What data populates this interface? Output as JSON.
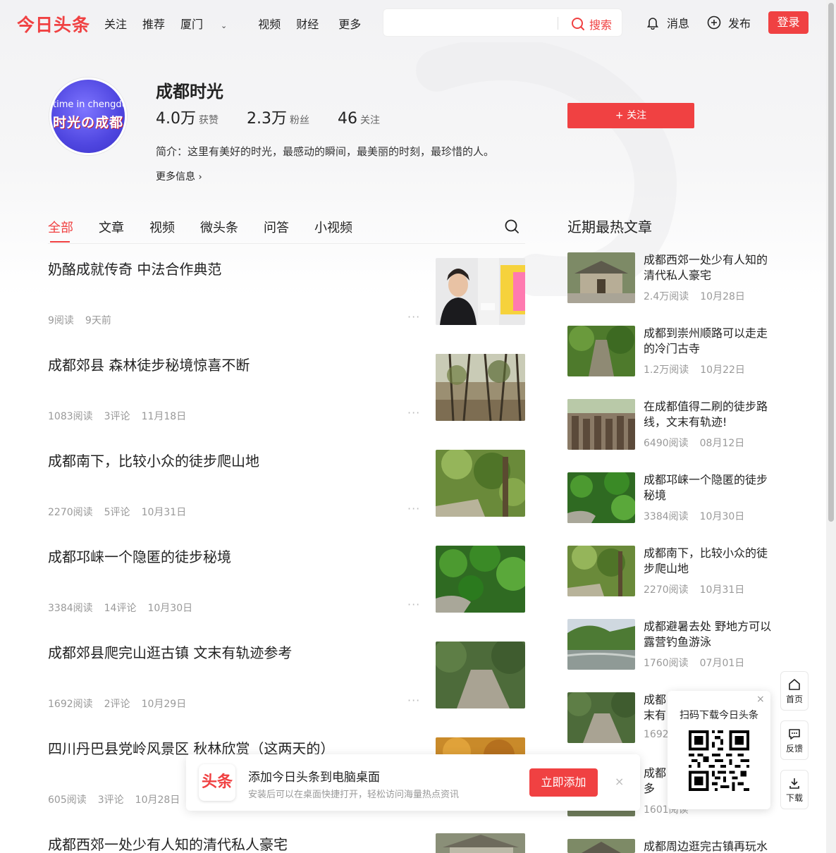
{
  "header": {
    "logo": "今日头条",
    "nav": [
      "关注",
      "推荐",
      "厦门",
      "视频",
      "财经",
      "更多"
    ],
    "search_placeholder": "",
    "search_label": "搜索",
    "messages": "消息",
    "publish": "发布",
    "login": "登录"
  },
  "profile": {
    "avatar_text_line1": "time in chengdu",
    "avatar_text_line2": "时光の成都",
    "name": "成都时光",
    "stats": [
      {
        "value": "4.0万",
        "label": "获赞"
      },
      {
        "value": "2.3万",
        "label": "粉丝"
      },
      {
        "value": "46",
        "label": "关注"
      }
    ],
    "follow": "+ 关注",
    "intro": "简介：这里有美好的时光，最感动的瞬间，最美丽的时刻，最珍惜的人。",
    "more_info": "更多信息"
  },
  "tabs": [
    "全部",
    "文章",
    "视频",
    "微头条",
    "问答",
    "小视频"
  ],
  "feed": [
    {
      "title": "奶酪成就传奇 中法合作典范",
      "reads": "9阅读",
      "comments": "",
      "date": "9天前"
    },
    {
      "title": "成都郊县 森林徒步秘境惊喜不断",
      "reads": "1083阅读",
      "comments": "3评论",
      "date": "11月18日"
    },
    {
      "title": "成都南下，比较小众的徒步爬山地",
      "reads": "2270阅读",
      "comments": "5评论",
      "date": "10月31日"
    },
    {
      "title": "成都邛崃一个隐匿的徒步秘境",
      "reads": "3384阅读",
      "comments": "14评论",
      "date": "10月30日"
    },
    {
      "title": "成都郊县爬完山逛古镇 文末有轨迹参考",
      "reads": "1692阅读",
      "comments": "2评论",
      "date": "10月29日"
    },
    {
      "title": "四川丹巴县党岭风景区 秋林欣赏（这两天的）",
      "reads": "605阅读",
      "comments": "3评论",
      "date": "10月28日"
    },
    {
      "title": "成都西郊一处少有人知的清代私人豪宅",
      "reads": "",
      "comments": "",
      "date": ""
    }
  ],
  "sidebar": {
    "heading": "近期最热文章",
    "items": [
      {
        "title": "成都西郊一处少有人知的清代私人豪宅",
        "reads": "2.4万阅读",
        "date": "10月28日"
      },
      {
        "title": "成都到崇州顺路可以走走的冷门古寺",
        "reads": "1.2万阅读",
        "date": "10月22日"
      },
      {
        "title": "在成都值得二刷的徒步路线，文末有轨迹!",
        "reads": "6490阅读",
        "date": "08月12日"
      },
      {
        "title": "成都邛崃一个隐匿的徒步秘境",
        "reads": "3384阅读",
        "date": "10月30日"
      },
      {
        "title": "成都南下，比较小众的徒步爬山地",
        "reads": "2270阅读",
        "date": "10月31日"
      },
      {
        "title": "成都避暑去处 野地方可以露营钓鱼游泳",
        "reads": "1760阅读",
        "date": "07月01日"
      },
      {
        "title": "成都",
        "line2": "末有",
        "reads": "1692",
        "date": ""
      },
      {
        "title": "成都",
        "line2": "多",
        "reads": "1601阅读",
        "date": ""
      },
      {
        "title": "成都周边逛完古镇再玩水",
        "reads": "",
        "date": ""
      }
    ]
  },
  "floatbar": [
    "首页",
    "反馈",
    "下载"
  ],
  "qr_popup": {
    "title": "扫码下载今日头条",
    "close": "×"
  },
  "add_desktop": {
    "logo": "头条",
    "title": "添加今日头条到电脑桌面",
    "subtitle": "安装后可以在桌面快捷打开，轻松访问海量热点资讯",
    "button": "立即添加",
    "close": "×"
  },
  "colors": {
    "brand": "#f04142",
    "text": "#222222",
    "meta": "#999999"
  }
}
